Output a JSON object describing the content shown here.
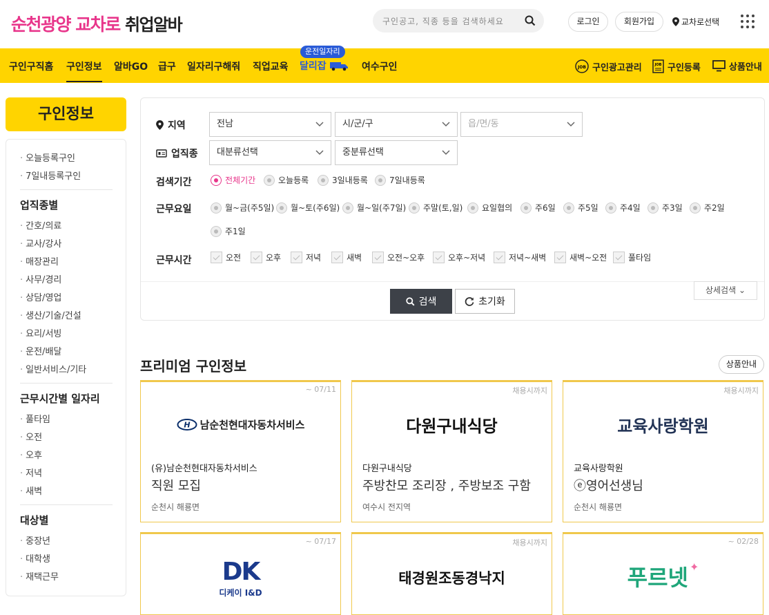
{
  "header": {
    "logo_brand": "순천광양 교차로",
    "logo_suffix": "취업알바",
    "search_placeholder": "구인공고, 직종 등을 검색하세요",
    "login": "로그인",
    "signup": "회원가입",
    "region": "교차로선택"
  },
  "nav": {
    "items": [
      "구인구직홈",
      "구인정보",
      "알바GO",
      "급구",
      "일자리구해줘",
      "직업교육",
      "달리잡",
      "여수구인"
    ],
    "badge": "운전일자리",
    "right": [
      "구인광고관리",
      "구인등록",
      "상품안내"
    ]
  },
  "sidebar": {
    "title": "구인정보",
    "top_items": [
      "오늘등록구인",
      "7일내등록구인"
    ],
    "sections": [
      {
        "title": "업직종별",
        "items": [
          "간호/의료",
          "교사/강사",
          "매장관리",
          "사무/경리",
          "상담/영업",
          "생산/기술/건설",
          "요리/서빙",
          "운전/배달",
          "일반서비스/기타"
        ]
      },
      {
        "title": "근무시간별 일자리",
        "items": [
          "풀타임",
          "오전",
          "오후",
          "저녁",
          "새벽"
        ]
      },
      {
        "title": "대상별",
        "items": [
          "중장년",
          "대학생",
          "재택근무"
        ]
      }
    ]
  },
  "filters": {
    "region_label": "지역",
    "region_selects": [
      "전남",
      "시/군/구",
      "읍/면/동"
    ],
    "job_label": "업직종",
    "job_selects": [
      "대분류선택",
      "중분류선택"
    ],
    "period_label": "검색기간",
    "periods": [
      "전체기간",
      "오늘등록",
      "3일내등록",
      "7일내등록"
    ],
    "days_label": "근무요일",
    "days": [
      "월~금(주5일)",
      "월~토(주6일)",
      "월~일(주7일)",
      "주말(토,일)",
      "요일협의",
      "주6일",
      "주5일",
      "주4일",
      "주3일",
      "주2일",
      "주1일"
    ],
    "hours_label": "근무시간",
    "hours": [
      "오전",
      "오후",
      "저녁",
      "새벽",
      "오전~오후",
      "오후~저녁",
      "저녁~새벽",
      "새벽~오전",
      "풀타임"
    ],
    "search_btn": "검색",
    "reset_btn": "초기화",
    "detail_btn": "상세검색"
  },
  "premium": {
    "title": "프리미엄 구인정보",
    "guide": "상품안내",
    "cards": [
      {
        "date": "~ 07/11",
        "logo": "남순천현대자동차서비스",
        "company": "(유)남순천현대자동차서비스",
        "title": "직원 모집",
        "location": "순천시 해룡면"
      },
      {
        "date": "채용시까지",
        "logo": "다원구내식당",
        "company": "다원구내식당",
        "title": "주방찬모 조리장 , 주방보조 구함",
        "location": "여수시 전지역"
      },
      {
        "date": "채용시까지",
        "logo": "교육사랑학원",
        "company": "교육사랑학원",
        "title": "ⓔ영어선생님",
        "location": "순천시 해룡면"
      },
      {
        "date": "~ 07/17",
        "logo": "디케이 I&D",
        "logo_mark": "DK"
      },
      {
        "date": "채용시까지",
        "logo": "태경원조동경낙지"
      },
      {
        "date": "~ 02/28",
        "logo": "푸르넷"
      }
    ]
  },
  "colors": {
    "brand": "#e8368b",
    "nav_bg": "#ffd400",
    "accent_blue": "#2a5bd7",
    "card_border": "#f0c84c"
  }
}
